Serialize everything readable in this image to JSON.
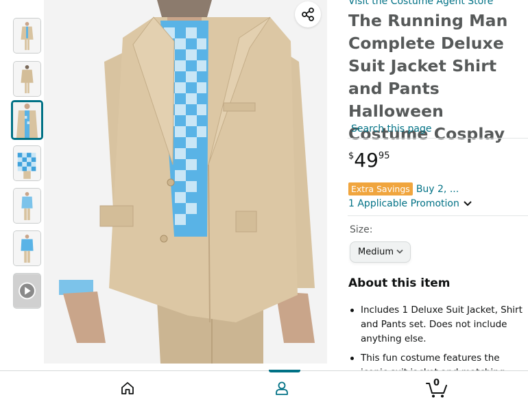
{
  "store": {
    "link_text": "Visit the Costume Agent Store"
  },
  "product": {
    "title": "The Running Man Complete Deluxe Suit Jacket Shirt and Pants Halloween Costume Cosplay",
    "search_link": "Search this page",
    "price": {
      "symbol": "$",
      "whole": "49",
      "fraction": "95"
    },
    "savings_badge": "Extra Savings",
    "savings_link": "Buy 2, ...",
    "promotion_link": "1 Applicable Promotion",
    "size_label": "Size:",
    "size_selected": "Medium",
    "about_heading": "About this item",
    "bullets": [
      "Includes 1 Deluxe Suit Jacket, Shirt and Pants set. Does not include anything else.",
      "This fun costume features the iconic suit jacket and matching pants. It"
    ]
  },
  "gallery": {
    "thumbnails": [
      "jacket-front",
      "jacket-back",
      "jacket-closeup",
      "shirt-pattern",
      "shirt-and-pants",
      "shirt-front",
      "video"
    ],
    "active_index": 2
  },
  "bottom_nav": {
    "items": [
      "home-icon",
      "account-icon",
      "cart-icon"
    ],
    "active": "account-icon",
    "cart_count": "0"
  },
  "colors": {
    "link": "#007185",
    "badge": "#f0a53e",
    "jacket": "#d8c3a0",
    "shirt_light": "#c9e6f6",
    "shirt_dark": "#3fa2dc"
  }
}
